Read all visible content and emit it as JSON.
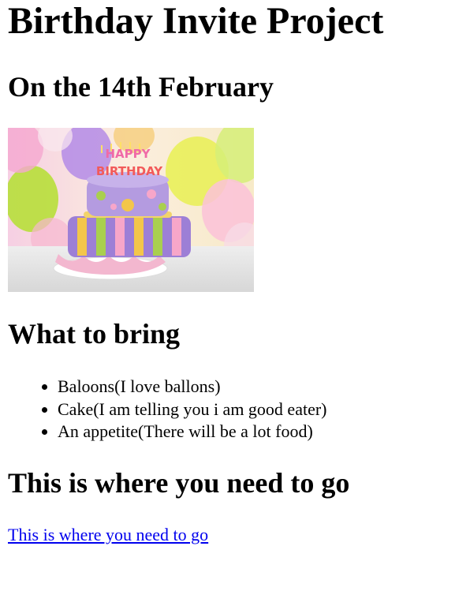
{
  "heading": "Birthday Invite Project",
  "date_heading": "On the 14th February",
  "image": {
    "topper_top": "HAPPY",
    "topper_bottom": "BIRTHDAY",
    "colors": {
      "top_tier": "#b49be0",
      "bottom_stripe_a": "#9d7fd6",
      "bottom_stripe_b": "#f3c64a",
      "bottom_stripe_c": "#a9cf4f",
      "ruffle": "#f3b7cf"
    }
  },
  "bring_heading": "What to bring",
  "bring_items": [
    "Baloons(I love ballons)",
    "Cake(I am telling you i am good eater)",
    "An appetite(There will be a lot food)"
  ],
  "go_heading": "This is where you need to go",
  "go_link_text": "This is where you need to go",
  "link_color": "#0000ee"
}
